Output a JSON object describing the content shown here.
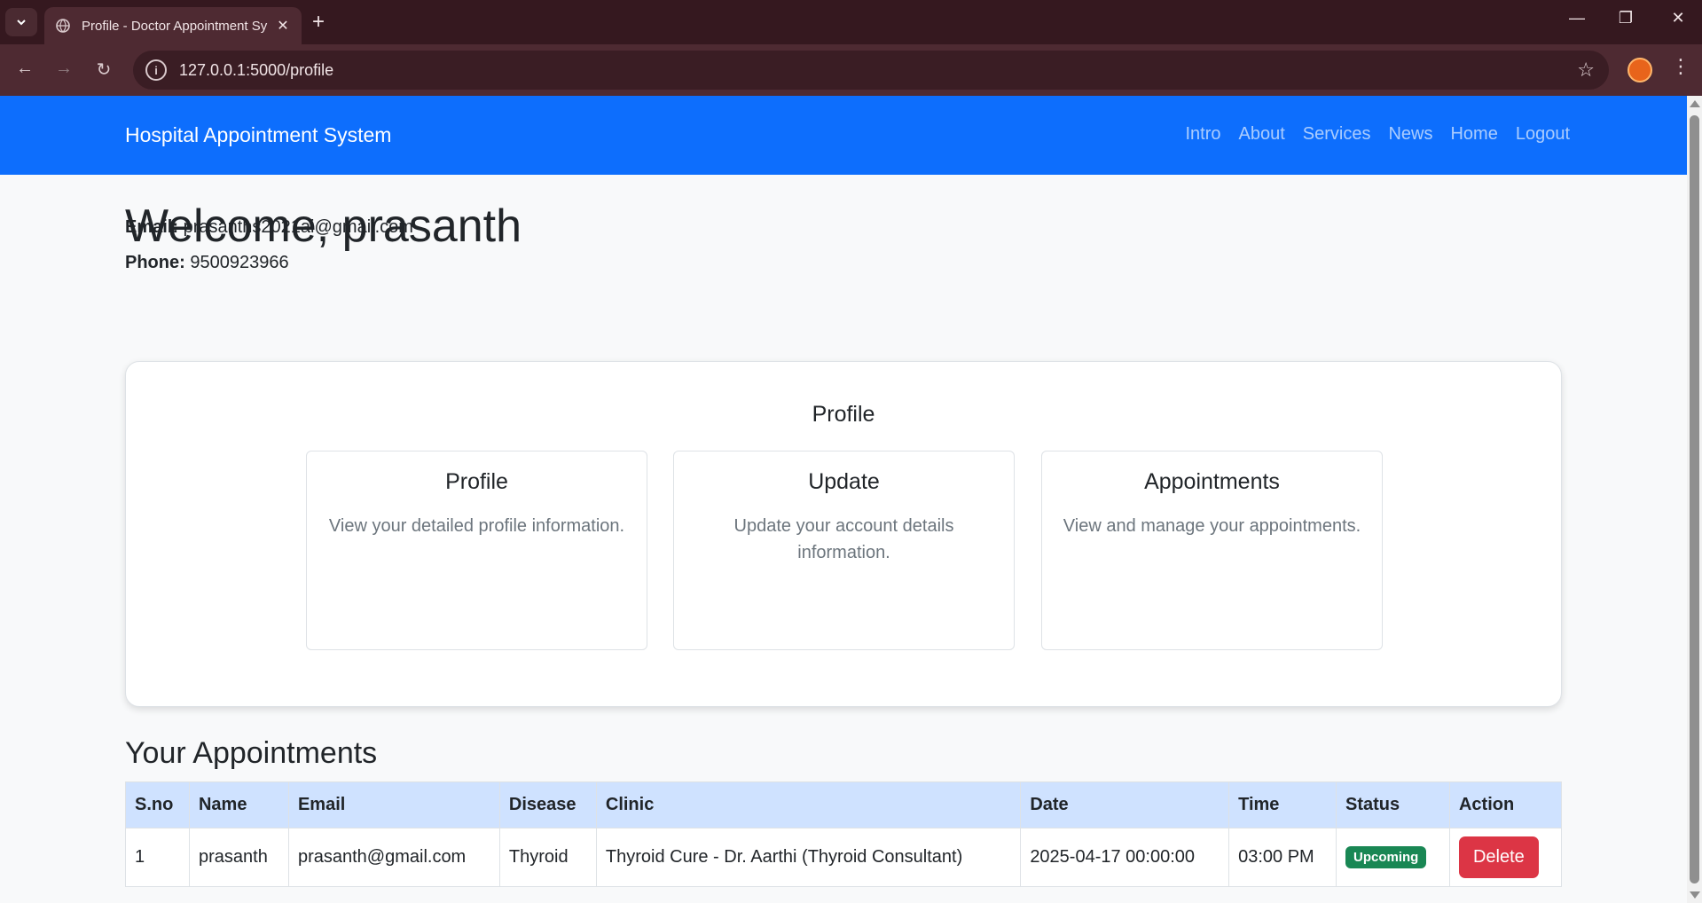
{
  "browser": {
    "tab_title": "Profile - Doctor Appointment Sy",
    "url": "127.0.0.1:5000/profile"
  },
  "navbar": {
    "brand": "Hospital Appointment System",
    "links": [
      "Intro",
      "About",
      "Services",
      "News",
      "Home",
      "Logout"
    ]
  },
  "profile": {
    "welcome": "Welcome, prasanth",
    "email_label": "Email:",
    "email": "prasanths2021ai@gmail.com",
    "phone_label": "Phone:",
    "phone": "9500923966"
  },
  "card": {
    "heading": "Profile",
    "items": [
      {
        "title": "Profile",
        "desc": "View your detailed profile information."
      },
      {
        "title": "Update",
        "desc": "Update your account details information."
      },
      {
        "title": "Appointments",
        "desc": "View and manage your appointments."
      }
    ]
  },
  "appointments": {
    "title": "Your Appointments",
    "headers": [
      "S.no",
      "Name",
      "Email",
      "Disease",
      "Clinic",
      "Date",
      "Time",
      "Status",
      "Action"
    ],
    "rows": [
      {
        "sno": "1",
        "name": "prasanth",
        "email": "prasanth@gmail.com",
        "disease": "Thyroid",
        "clinic": "Thyroid Cure - Dr. Aarthi (Thyroid Consultant)",
        "date": "2025-04-17 00:00:00",
        "time": "03:00 PM",
        "status": "Upcoming",
        "action": "Delete"
      }
    ]
  },
  "colors": {
    "navbar": "#0d6efd",
    "table_header": "#cfe2ff",
    "status_upcoming": "#198754",
    "delete_button": "#dc3545"
  }
}
